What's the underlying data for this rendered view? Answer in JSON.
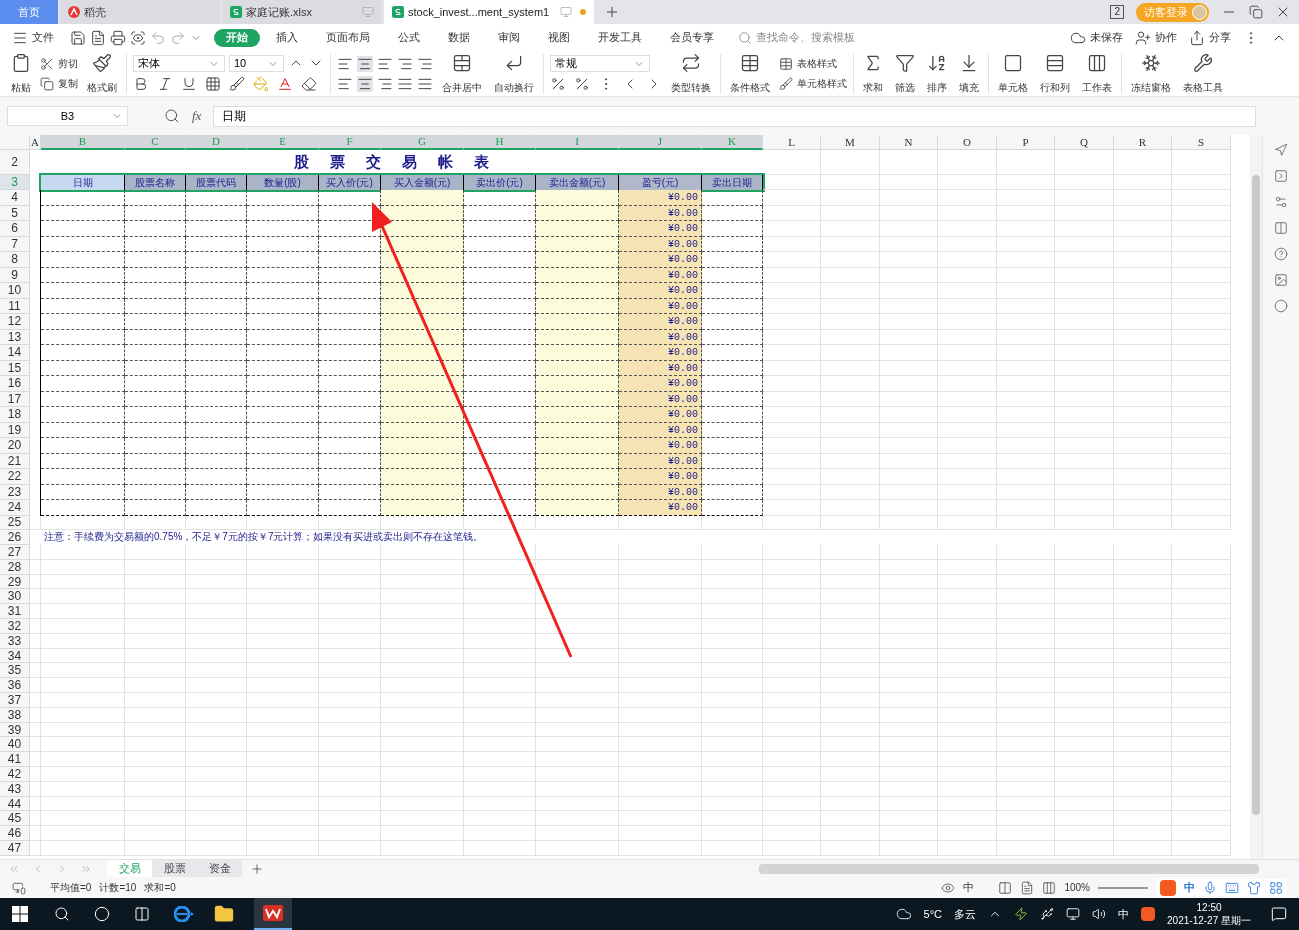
{
  "tabs": [
    {
      "label": "首页",
      "kind": "home",
      "selected": false
    },
    {
      "label": "稻壳",
      "kind": "docer",
      "selected": false
    },
    {
      "label": "家庭记账.xlsx",
      "kind": "sheet",
      "selected": false
    },
    {
      "label": "stock_invest...ment_system1",
      "kind": "sheet",
      "selected": true
    }
  ],
  "account": {
    "page_badge": "2",
    "login": "访客登录"
  },
  "menu": {
    "file": "文件",
    "tabs": [
      {
        "label": "开始",
        "selected": true
      },
      {
        "label": "插入",
        "selected": false
      },
      {
        "label": "页面布局",
        "selected": false
      },
      {
        "label": "公式",
        "selected": false
      },
      {
        "label": "数据",
        "selected": false
      },
      {
        "label": "审阅",
        "selected": false
      },
      {
        "label": "视图",
        "selected": false
      },
      {
        "label": "开发工具",
        "selected": false
      },
      {
        "label": "会员专享",
        "selected": false
      }
    ],
    "search": {
      "placeholder": "查找命令、搜索模板"
    },
    "save_state": "未保存",
    "collab": "协作",
    "share": "分享"
  },
  "ribbon": {
    "paste": "粘贴",
    "cut": "剪切",
    "copy": "复制",
    "format_painter": "格式刷",
    "font": "宋体",
    "size": "10",
    "merge": "合并居中",
    "wrap": "自动换行",
    "number_format": "常规",
    "convert": "类型转换",
    "conditional": "条件格式",
    "table_style": "表格样式",
    "cell_style": "单元格样式",
    "sum": "求和",
    "filter": "筛选",
    "sort": "排序",
    "fill": "填充",
    "cell": "单元格",
    "rowcol": "行和列",
    "worksheet": "工作表",
    "freeze": "冻结窗格",
    "tools": "表格工具"
  },
  "formula_bar": {
    "name_box": "B3",
    "function_label": "fx",
    "value": "日期"
  },
  "columns": [
    {
      "label": "A",
      "selected": false
    },
    {
      "label": "B",
      "selected": true
    },
    {
      "label": "C",
      "selected": true
    },
    {
      "label": "D",
      "selected": true
    },
    {
      "label": "E",
      "selected": true
    },
    {
      "label": "F",
      "selected": true
    },
    {
      "label": "G",
      "selected": true
    },
    {
      "label": "H",
      "selected": true
    },
    {
      "label": "I",
      "selected": true
    },
    {
      "label": "J",
      "selected": true
    },
    {
      "label": "K",
      "selected": true
    },
    {
      "label": "L",
      "selected": false
    },
    {
      "label": "M",
      "selected": false
    },
    {
      "label": "N",
      "selected": false
    },
    {
      "label": "O",
      "selected": false
    },
    {
      "label": "P",
      "selected": false
    },
    {
      "label": "Q",
      "selected": false
    },
    {
      "label": "R",
      "selected": false
    },
    {
      "label": "S",
      "selected": false
    }
  ],
  "sheet": {
    "title": "股票交易帐表",
    "headers": [
      {
        "label": "日期",
        "kind": "plain",
        "selected": true
      },
      {
        "label": "股票名称",
        "kind": "plain",
        "selected": false
      },
      {
        "label": "股票代码",
        "kind": "plain",
        "selected": false
      },
      {
        "label": "数量(股)",
        "kind": "plain",
        "selected": false
      },
      {
        "label": "买入价(元)",
        "kind": "plain",
        "selected": false
      },
      {
        "label": "买入金额(元)",
        "kind": "amount",
        "selected": false
      },
      {
        "label": "卖出价(元)",
        "kind": "plain",
        "selected": false
      },
      {
        "label": "卖出金额(元)",
        "kind": "amount",
        "selected": false
      },
      {
        "label": "盈亏(元)",
        "kind": "profit",
        "selected": false
      },
      {
        "label": "卖出日期",
        "kind": "plain",
        "selected": false
      }
    ],
    "rows": [
      {
        "row": "4",
        "profit": "¥0.00"
      },
      {
        "row": "5",
        "profit": "¥0.00"
      },
      {
        "row": "6",
        "profit": "¥0.00"
      },
      {
        "row": "7",
        "profit": "¥0.00"
      },
      {
        "row": "8",
        "profit": "¥0.00"
      },
      {
        "row": "9",
        "profit": "¥0.00"
      },
      {
        "row": "10",
        "profit": "¥0.00"
      },
      {
        "row": "11",
        "profit": "¥0.00"
      },
      {
        "row": "12",
        "profit": "¥0.00"
      },
      {
        "row": "13",
        "profit": "¥0.00"
      },
      {
        "row": "14",
        "profit": "¥0.00"
      },
      {
        "row": "15",
        "profit": "¥0.00"
      },
      {
        "row": "16",
        "profit": "¥0.00"
      },
      {
        "row": "17",
        "profit": "¥0.00"
      },
      {
        "row": "18",
        "profit": "¥0.00"
      },
      {
        "row": "19",
        "profit": "¥0.00"
      },
      {
        "row": "20",
        "profit": "¥0.00"
      },
      {
        "row": "21",
        "profit": "¥0.00"
      },
      {
        "row": "22",
        "profit": "¥0.00"
      },
      {
        "row": "23",
        "profit": "¥0.00"
      },
      {
        "row": "24",
        "profit": "¥0.00"
      }
    ],
    "title_row": "2",
    "header_row": "3",
    "empty_rows": [
      "25",
      "26",
      "27",
      "28",
      "29",
      "30",
      "31",
      "32",
      "33",
      "34",
      "35",
      "36",
      "37",
      "38",
      "39",
      "40",
      "41",
      "42",
      "43",
      "44",
      "45",
      "46",
      "47"
    ],
    "note": "注意：手续费为交易额的0.75%，不足￥7元的按￥7元计算；如果没有买进或卖出则不存在这笔钱。"
  },
  "sheet_tabs": [
    {
      "label": "交易",
      "selected": true
    },
    {
      "label": "股票",
      "selected": false
    },
    {
      "label": "资金",
      "selected": false
    }
  ],
  "status": {
    "stats": [
      "平均值=0",
      "计数=10",
      "求和=0"
    ],
    "lang": "中",
    "zoom": "100%",
    "ime": "中"
  },
  "taskbar": {
    "weather": "5°C",
    "sky": "多云",
    "ime": "中",
    "time": "12:50",
    "date": "2021-12-27 星期一"
  }
}
